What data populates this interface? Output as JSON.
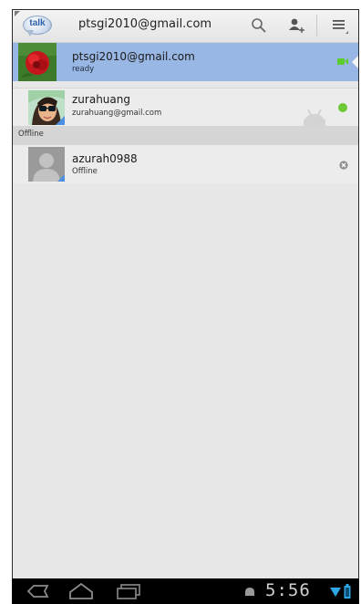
{
  "header": {
    "logo_text": "talk",
    "account": "ptsgi2010@gmail.com",
    "icons": [
      "search-icon",
      "add-contact-icon",
      "menu-icon"
    ]
  },
  "self": {
    "name": "ptsgi2010@gmail.com",
    "status": "ready",
    "status_icon": "video-camera-icon",
    "status_color": "#5dcc2e",
    "highlight_color": "#99b7e4"
  },
  "contacts": [
    {
      "name": "zurahuang",
      "detail": "zurahuang@gmail.com",
      "status": "available",
      "status_color": "#6cc934",
      "device_icon": "android-icon"
    }
  ],
  "offline_section": {
    "title": "Offline",
    "contacts": [
      {
        "name": "azurah0988",
        "detail": "Offline",
        "status_icon": "offline-x-icon"
      }
    ]
  },
  "navbar": {
    "time": "5:56",
    "icons": [
      "back-icon",
      "home-icon",
      "recent-apps-icon",
      "android-debug-icon",
      "wifi-icon",
      "battery-icon"
    ]
  }
}
